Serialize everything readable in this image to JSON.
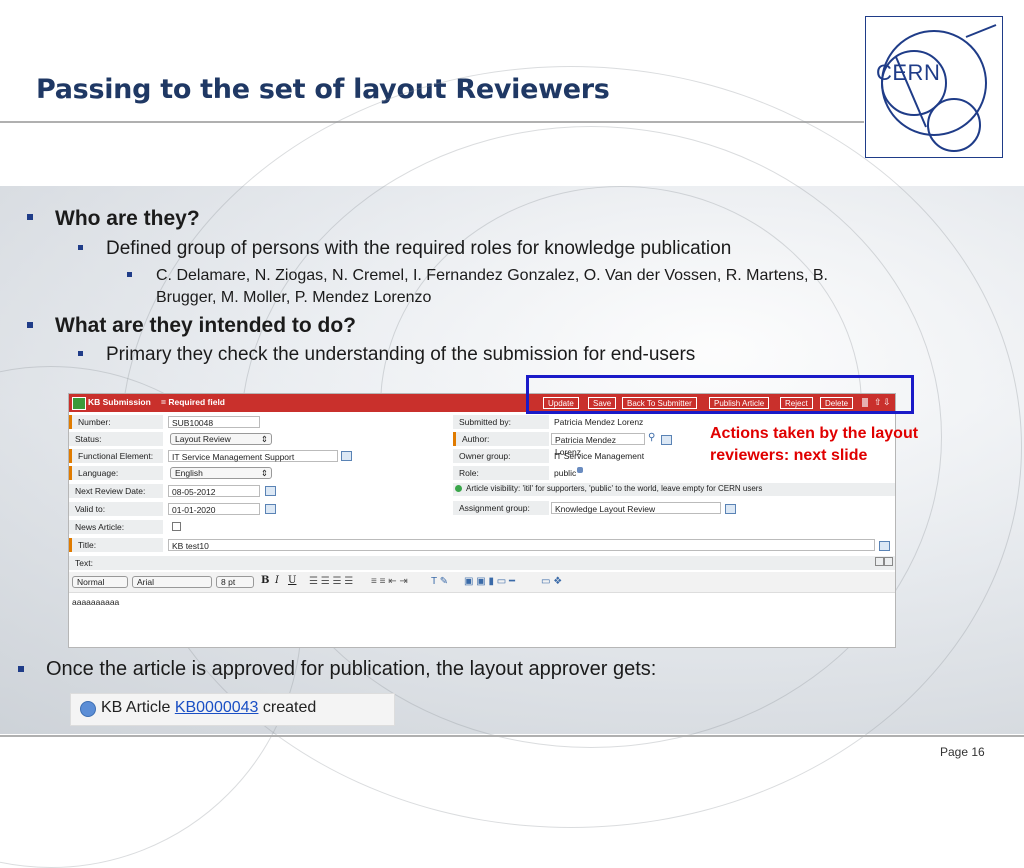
{
  "slide": {
    "title": "Passing to the set of layout Reviewers",
    "logo_text": "CERN",
    "page_label": "Page 16"
  },
  "colors": {
    "title": "#1f3864",
    "bullet": "#1f3c88",
    "form_bar": "#c9302c",
    "annotation": "#e00000",
    "highlight": "#1a1ac8"
  },
  "bullets": {
    "b1": "Who are they?",
    "b1a": "Defined group of persons with the required roles for knowledge publication",
    "b1a_i_line1": "C. Delamare, N. Ziogas, N. Cremel, I. Fernandez Gonzalez, O. Van der Vossen, R. Martens, B.",
    "b1a_i_line2": "Brugger,  M. Moller, P. Mendez Lorenzo",
    "b2": "What are they intended to do?",
    "b2a": "Primary they check the understanding of the submission for end-users",
    "b3": "Once the article is approved for publication, the layout approver gets:"
  },
  "form": {
    "header_title": "KB Submission",
    "header_required": "= Required field",
    "buttons": [
      "Update",
      "Save",
      "Back To Submitter",
      "Publish Article",
      "Reject",
      "Delete"
    ],
    "left": {
      "number_label": "Number:",
      "number_value": "SUB10048",
      "status_label": "Status:",
      "status_value": "Layout Review",
      "functional_label": "Functional Element:",
      "functional_value": "IT Service Management Support",
      "language_label": "Language:",
      "language_value": "English",
      "review_label": "Next Review Date:",
      "review_value": "08-05-2012",
      "valid_label": "Valid to:",
      "valid_value": "01-01-2020",
      "news_label": "News Article:",
      "title_label": "Title:",
      "title_value": "KB test10",
      "text_label": "Text:"
    },
    "right": {
      "submitted_label": "Submitted by:",
      "submitted_value": "Patricia Mendez Lorenz",
      "author_label": "Author:",
      "author_value": "Patricia Mendez Lorenz",
      "owner_label": "Owner group:",
      "owner_value": "IT Service Management",
      "role_label": "Role:",
      "role_value": "public",
      "visibility_text": "Article visibility: 'itil' for supporters, 'public' to the world, leave empty for CERN users",
      "assignment_label": "Assignment group:",
      "assignment_value": "Knowledge Layout Review"
    },
    "editor": {
      "style": "Normal",
      "font": "Arial",
      "size": "8 pt",
      "bold": "B",
      "italic": "I",
      "underline": "U",
      "body": "aaaaaaaaaa"
    }
  },
  "annotation": {
    "line1": "Actions taken by the layout",
    "line2": "reviewers: next slide"
  },
  "notification": {
    "prefix": "KB Article",
    "link": "KB0000043",
    "suffix": "created"
  }
}
